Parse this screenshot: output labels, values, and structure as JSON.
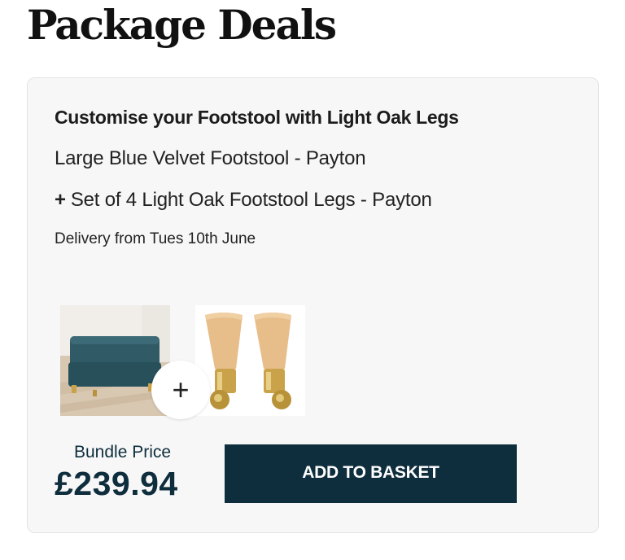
{
  "page": {
    "title": "Package Deals"
  },
  "deal": {
    "heading": "Customise your Footstool with Light Oak Legs",
    "item_1": "Large Blue Velvet Footstool - Payton",
    "item_2_prefix": "+",
    "item_2": "Set of 4 Light Oak Footstool Legs - Payton",
    "delivery": "Delivery from Tues 10th June",
    "combine_symbol": "+",
    "bundle_label": "Bundle Price",
    "bundle_price": "£239.94",
    "add_button": "ADD TO BASKET"
  },
  "colors": {
    "brand_navy": "#0f2e3d",
    "card_bg": "#f7f7f7",
    "velvet_blue": "#2f5a66",
    "oak": "#e7bd8a",
    "brass": "#c9a24a"
  }
}
